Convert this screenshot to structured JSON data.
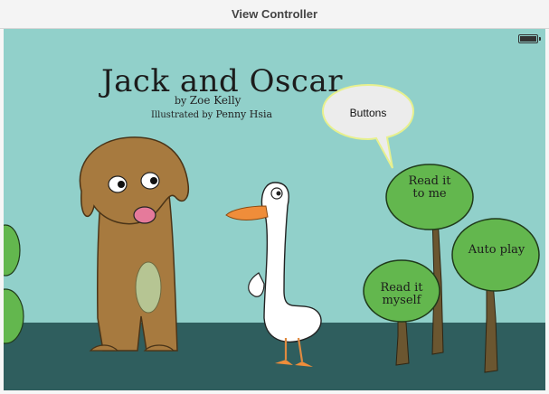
{
  "window": {
    "title": "View Controller"
  },
  "status_bar": {
    "icon": "battery-icon"
  },
  "book": {
    "title": "Jack and Oscar",
    "author_prefix": "by",
    "author": "Zoe Kelly",
    "illustrator_prefix": "Illustrated by",
    "illustrator": "Penny Hsia"
  },
  "annotation": {
    "callout_text": "Buttons"
  },
  "buttons": {
    "read_to_me": {
      "line1": "Read it",
      "line2": "to me"
    },
    "auto_play": {
      "label": "Auto play"
    },
    "read_myself": {
      "line1": "Read it",
      "line2": "myself"
    }
  },
  "colors": {
    "sky": "#91d0ca",
    "ground": "#2f5e5e",
    "tree_green": "#63b74e",
    "trunk": "#6b5630",
    "dog": "#a77a3f",
    "duck_beak": "#ef8d3a",
    "callout_fill": "#ececec",
    "callout_border": "#e7f08e"
  }
}
